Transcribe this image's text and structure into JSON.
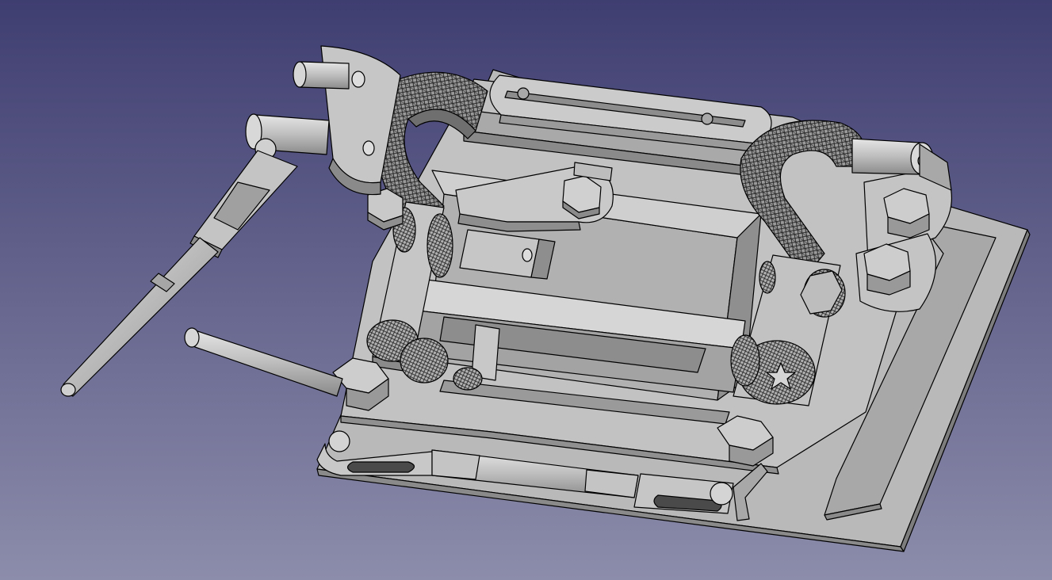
{
  "viewport": {
    "background_top": "#3f3e71",
    "background_bottom": "#8c8cab"
  },
  "model": {
    "face_color": "#b4b4b4",
    "face_light": "#d0d0d0",
    "face_dark": "#8e8e8e",
    "edge_color": "#000000",
    "parts": [
      "base-plate",
      "frame-plate",
      "inner-carriage",
      "guide-rail",
      "flex-cable-left",
      "flex-cable-right",
      "swing-arm",
      "lever-pin",
      "rod-assembly",
      "bottom-tie-rod",
      "hex-bolts",
      "gear-wheels"
    ]
  }
}
